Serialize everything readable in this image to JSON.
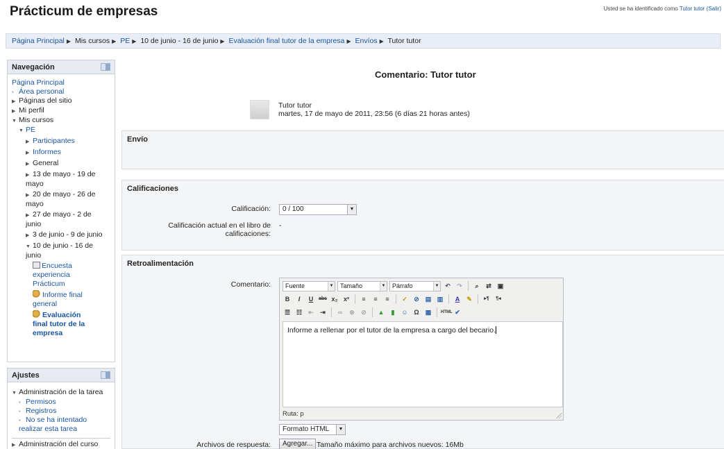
{
  "header": {
    "title": "Prácticum de empresas",
    "login_prefix": "Usted se ha identificado como",
    "login_user": "Tutor tutor",
    "logout": "(Salir)"
  },
  "breadcrumb": [
    {
      "label": "Página Principal",
      "link": true
    },
    {
      "label": "Mis cursos",
      "link": false
    },
    {
      "label": "PE",
      "link": true
    },
    {
      "label": "10 de junio - 16 de junio",
      "link": false
    },
    {
      "label": "Evaluación final tutor de la empresa",
      "link": true
    },
    {
      "label": "Envíos",
      "link": true
    },
    {
      "label": "Tutor tutor",
      "link": false
    }
  ],
  "navigation": {
    "title": "Navegación",
    "home": "Página Principal",
    "area_personal": "Área personal",
    "paginas_sitio": "Páginas del sitio",
    "mi_perfil": "Mi perfil",
    "mis_cursos": "Mis cursos",
    "pe": "PE",
    "participantes": "Participantes",
    "informes": "Informes",
    "general": "General",
    "week1": "13 de mayo - 19 de mayo",
    "week2": "20 de mayo - 26 de mayo",
    "week3": "27 de mayo - 2 de junio",
    "week4": "3 de junio - 9 de junio",
    "week5": "10 de junio - 16 de junio",
    "encuesta": "Encuesta experiencia Prácticum",
    "informe_final": "Informe final general",
    "evaluacion_final": "Evaluación final tutor de la empresa"
  },
  "settings": {
    "title": "Ajustes",
    "admin_tarea": "Administración de la tarea",
    "permisos": "Permisos",
    "registros": "Registros",
    "no_intentado": "No se ha intentado realizar esta tarea",
    "admin_curso": "Administración del curso"
  },
  "main": {
    "comment_title": "Comentario: Tutor tutor",
    "author_name": "Tutor tutor",
    "author_date": "martes, 17 de mayo de 2011, 23:56 (6 días 21 horas antes)",
    "envio_legend": "Envío",
    "calificaciones_legend": "Calificaciones",
    "calificacion_label": "Calificación:",
    "calificacion_value": "0 / 100",
    "calif_actual_label": "Calificación actual en el libro de calificaciones:",
    "calif_actual_value": "-",
    "retro_legend": "Retroalimentación",
    "comentario_label": "Comentario:",
    "editor": {
      "font": "Fuente",
      "size": "Tamaño",
      "format": "Párrafo",
      "content": "Informe a rellenar por el tutor de la empresa a cargo del becario.",
      "path": "Ruta: p"
    },
    "format_value": "Formato HTML",
    "archivos_label": "Archivos de respuesta:",
    "agregar_button": "Agregar...",
    "max_size": "Tamaño máximo para archivos nuevos: 16Mb"
  }
}
